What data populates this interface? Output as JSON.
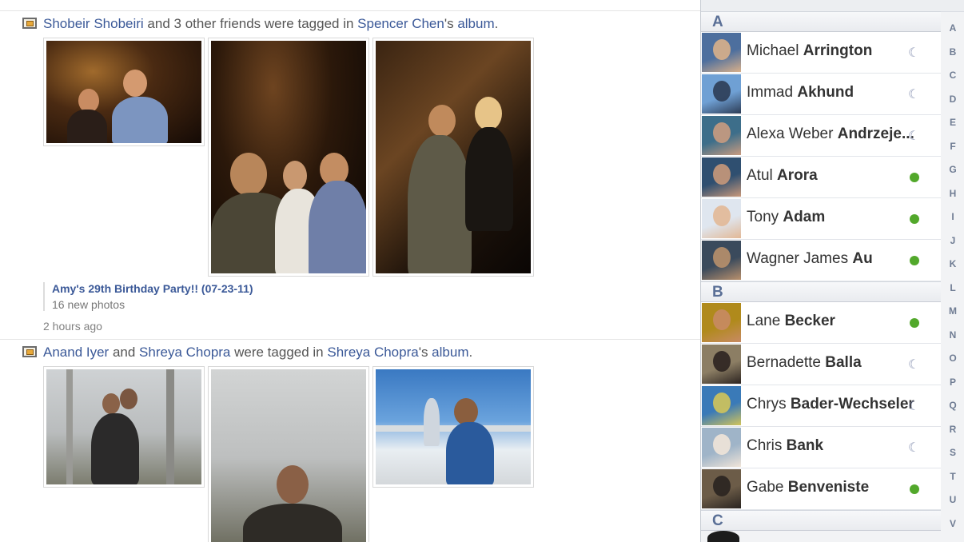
{
  "stories": [
    {
      "parts": [
        {
          "text": "Shobeir Shobeiri",
          "link": true
        },
        {
          "text": " and 3 other friends were tagged in ",
          "link": false
        },
        {
          "text": "Spencer Chen",
          "link": true
        },
        {
          "text": "'s ",
          "link": false
        },
        {
          "text": "album",
          "link": true
        },
        {
          "text": ".",
          "link": false
        }
      ],
      "album_title": "Amy's 29th Birthday Party!! (07-23-11)",
      "album_count": "16 new photos",
      "timestamp": "2 hours ago"
    },
    {
      "parts": [
        {
          "text": "Anand Iyer",
          "link": true
        },
        {
          "text": " and ",
          "link": false
        },
        {
          "text": "Shreya Chopra",
          "link": true
        },
        {
          "text": " were tagged in ",
          "link": false
        },
        {
          "text": "Shreya Chopra",
          "link": true
        },
        {
          "text": "'s ",
          "link": false
        },
        {
          "text": "album",
          "link": true
        },
        {
          "text": ".",
          "link": false
        }
      ]
    }
  ],
  "sidebar": {
    "sections": [
      {
        "letter": "A",
        "friends": [
          {
            "first": "Michael",
            "last": "Arrington",
            "status": "idle"
          },
          {
            "first": "Immad",
            "last": "Akhund",
            "status": "idle"
          },
          {
            "first": "Alexa Weber",
            "last": "Andrzeje...",
            "status": "idle"
          },
          {
            "first": "Atul",
            "last": "Arora",
            "status": "online"
          },
          {
            "first": "Tony",
            "last": "Adam",
            "status": "online"
          },
          {
            "first": "Wagner James",
            "last": "Au",
            "status": "online"
          }
        ]
      },
      {
        "letter": "B",
        "friends": [
          {
            "first": "Lane",
            "last": "Becker",
            "status": "online"
          },
          {
            "first": "Bernadette",
            "last": "Balla",
            "status": "idle"
          },
          {
            "first": "Chrys",
            "last": "Bader-Wechseler",
            "status": "idle"
          },
          {
            "first": "Chris",
            "last": "Bank",
            "status": "idle"
          },
          {
            "first": "Gabe",
            "last": "Benveniste",
            "status": "online"
          }
        ]
      },
      {
        "letter": "C",
        "friends": []
      }
    ],
    "alphabet": [
      "A",
      "B",
      "C",
      "D",
      "E",
      "F",
      "G",
      "H",
      "I",
      "J",
      "K",
      "L",
      "M",
      "N",
      "O",
      "P",
      "Q",
      "R",
      "S",
      "T",
      "U",
      "V"
    ],
    "colors": {
      "online": "#52a82b",
      "idle": "#8d97b5",
      "link": "#3b5998"
    }
  }
}
